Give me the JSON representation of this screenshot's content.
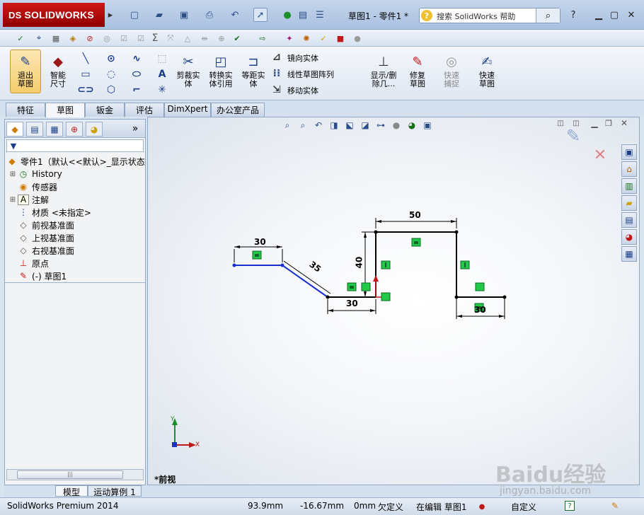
{
  "app": {
    "logo": "SOLIDWORKS",
    "doc_title": "草图1 - 零件1 *"
  },
  "help_search": {
    "placeholder": "搜索 SolidWorks 帮助"
  },
  "ribbon": {
    "exit_sketch": "退出草图",
    "smart_dim": "智能尺寸",
    "trim": "剪裁实体",
    "convert": "转换实体引用",
    "offset": "等距实体",
    "mirror": "镜向实体",
    "linear_pattern": "线性草图阵列",
    "move": "移动实体",
    "show_delete": "显示/删除几...",
    "repair": "修复草图",
    "quick_snaps": "快速捕捉",
    "rapid_sketch": "快速草图"
  },
  "tabs": [
    "特征",
    "草图",
    "钣金",
    "评估",
    "DimXpert",
    "办公室产品"
  ],
  "active_tab": "草图",
  "tree": {
    "root": "零件1（默认<<默认>_显示状态",
    "items": [
      "History",
      "传感器",
      "注解",
      "材质 <未指定>",
      "前视基准面",
      "上视基准面",
      "右视基准面",
      "原点",
      "(-) 草图1"
    ]
  },
  "bottom_tabs": [
    "模型",
    "运动算例 1"
  ],
  "viewport": {
    "view_label": "*前视"
  },
  "sketch": {
    "dims": [
      "30",
      "35",
      "30",
      "40",
      "50",
      "30"
    ],
    "triad_x": "X",
    "triad_y": "Y"
  },
  "status": {
    "product": "SolidWorks Premium 2014",
    "x": "93.9mm",
    "y": "-16.67mm",
    "z": "0mm",
    "state": "欠定义",
    "editing": "在编辑 草图1",
    "units": "自定义"
  },
  "watermark": {
    "text": "Baidu经验",
    "url": "jingyan.baidu.com"
  },
  "colors": {
    "accent": "#d01818",
    "sketch_line": "#000000",
    "selected_line": "#1a2fd0",
    "relation_box": "#22c84a"
  }
}
